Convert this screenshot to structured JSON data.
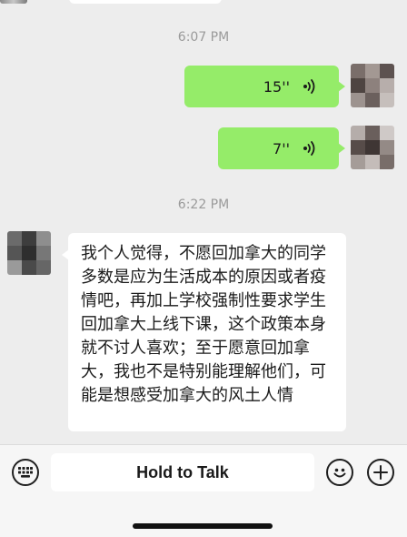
{
  "messages": [
    {
      "type": "timestamp",
      "text": "6:07 PM"
    },
    {
      "type": "voice",
      "side": "right",
      "duration": "15''",
      "icon": "voice-wave-icon"
    },
    {
      "type": "voice",
      "side": "right",
      "duration": "7''",
      "icon": "voice-wave-icon"
    },
    {
      "type": "timestamp",
      "text": "6:22 PM"
    },
    {
      "type": "text",
      "side": "left",
      "text": "我个人觉得，不愿回加拿大的同学多数是应为生活成本的原因或者疫情吧，再加上学校强制性要求学生回加拿大上线下课，这个政策本身就不讨人喜欢；至于愿意回加拿大，我也不是特别能理解他们，可能是想感受加拿大的风土人情"
    }
  ],
  "input_bar": {
    "hold_to_talk": "Hold to Talk",
    "left_icon": "keyboard-icon",
    "emoji_icon": "emoji-icon",
    "plus_icon": "plus-icon"
  },
  "colors": {
    "background": "#ededed",
    "outgoing_bubble": "#95ec69",
    "incoming_bubble": "#ffffff",
    "timestamp": "#9a9a9a"
  }
}
